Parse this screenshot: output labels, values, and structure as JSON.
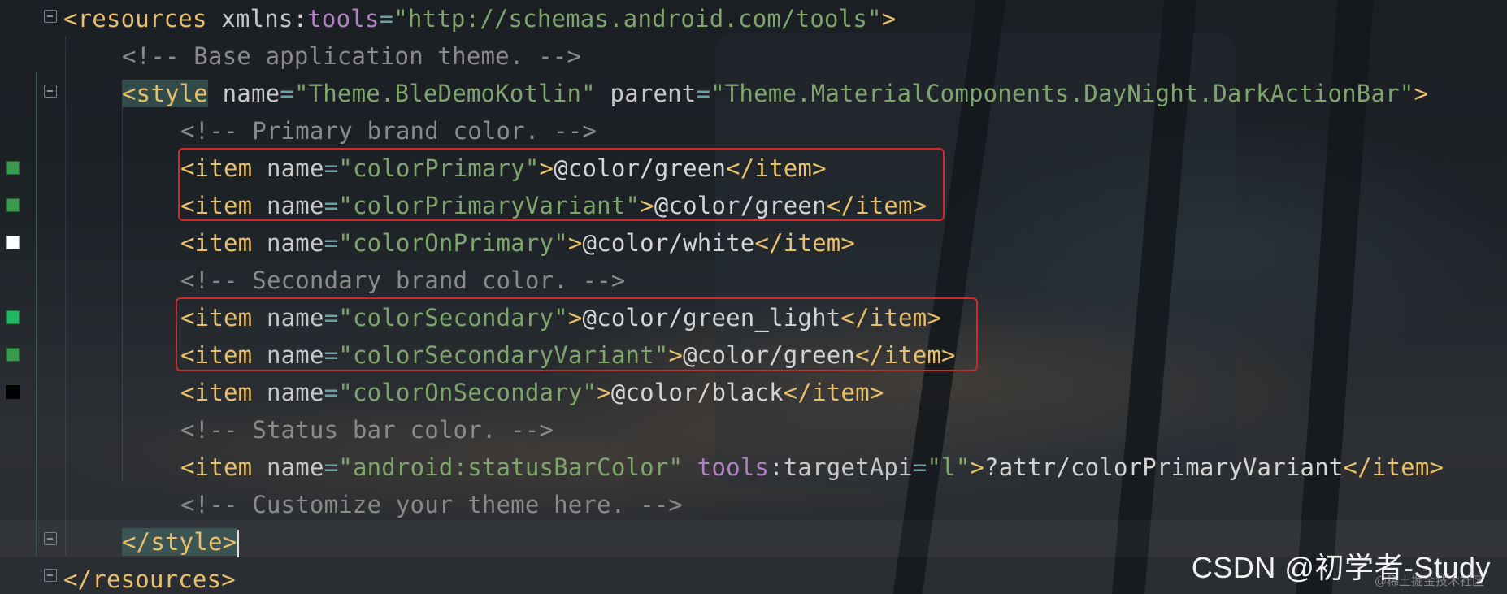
{
  "editor": {
    "lines": [
      {
        "segments": [
          {
            "t": "<",
            "c": "tag"
          },
          {
            "t": "resources",
            "c": "tag"
          },
          {
            "t": " xmlns",
            "c": "attr"
          },
          {
            "t": ":",
            "c": "txt"
          },
          {
            "t": "tools",
            "c": "ns"
          },
          {
            "t": "=",
            "c": "eq"
          },
          {
            "t": "\"http://schemas.android.com/tools\"",
            "c": "str"
          },
          {
            "t": ">",
            "c": "tag"
          }
        ]
      },
      {
        "segments": [
          {
            "t": "<!-- Base application theme. -->",
            "c": "cmt"
          }
        ]
      },
      {
        "segments": [
          {
            "t": "<style",
            "c": "tag-hl"
          },
          {
            "t": " name",
            "c": "attr"
          },
          {
            "t": "=",
            "c": "eq"
          },
          {
            "t": "\"Theme.BleDemoKotlin\"",
            "c": "str"
          },
          {
            "t": " parent",
            "c": "attr"
          },
          {
            "t": "=",
            "c": "eq"
          },
          {
            "t": "\"Theme.MaterialComponents.DayNight.DarkActionBar\"",
            "c": "str"
          },
          {
            "t": ">",
            "c": "tag"
          }
        ]
      },
      {
        "segments": [
          {
            "t": "<!-- Primary brand color. -->",
            "c": "cmt"
          }
        ]
      },
      {
        "segments": [
          {
            "t": "<item",
            "c": "tag"
          },
          {
            "t": " name",
            "c": "attr"
          },
          {
            "t": "=",
            "c": "eq"
          },
          {
            "t": "\"colorPrimary\"",
            "c": "str"
          },
          {
            "t": ">",
            "c": "tag"
          },
          {
            "t": "@color/green",
            "c": "txt"
          },
          {
            "t": "</item>",
            "c": "tag"
          }
        ]
      },
      {
        "segments": [
          {
            "t": "<item",
            "c": "tag"
          },
          {
            "t": " name",
            "c": "attr"
          },
          {
            "t": "=",
            "c": "eq"
          },
          {
            "t": "\"colorPrimaryVariant\"",
            "c": "str"
          },
          {
            "t": ">",
            "c": "tag"
          },
          {
            "t": "@color/green",
            "c": "txt"
          },
          {
            "t": "</item>",
            "c": "tag"
          }
        ]
      },
      {
        "segments": [
          {
            "t": "<item",
            "c": "tag"
          },
          {
            "t": " name",
            "c": "attr"
          },
          {
            "t": "=",
            "c": "eq"
          },
          {
            "t": "\"colorOnPrimary\"",
            "c": "str"
          },
          {
            "t": ">",
            "c": "tag"
          },
          {
            "t": "@color/white",
            "c": "txt"
          },
          {
            "t": "</item>",
            "c": "tag"
          }
        ]
      },
      {
        "segments": [
          {
            "t": "<!-- Secondary brand color. -->",
            "c": "cmt"
          }
        ]
      },
      {
        "segments": [
          {
            "t": "<item",
            "c": "tag"
          },
          {
            "t": " name",
            "c": "attr"
          },
          {
            "t": "=",
            "c": "eq"
          },
          {
            "t": "\"colorSecondary\"",
            "c": "str"
          },
          {
            "t": ">",
            "c": "tag"
          },
          {
            "t": "@color/green_light",
            "c": "txt"
          },
          {
            "t": "</item>",
            "c": "tag"
          }
        ]
      },
      {
        "segments": [
          {
            "t": "<item",
            "c": "tag"
          },
          {
            "t": " name",
            "c": "attr"
          },
          {
            "t": "=",
            "c": "eq"
          },
          {
            "t": "\"colorSecondaryVariant\"",
            "c": "str"
          },
          {
            "t": ">",
            "c": "tag"
          },
          {
            "t": "@color/green",
            "c": "txt"
          },
          {
            "t": "</item>",
            "c": "tag"
          }
        ]
      },
      {
        "segments": [
          {
            "t": "<item",
            "c": "tag"
          },
          {
            "t": " name",
            "c": "attr"
          },
          {
            "t": "=",
            "c": "eq"
          },
          {
            "t": "\"colorOnSecondary\"",
            "c": "str"
          },
          {
            "t": ">",
            "c": "tag"
          },
          {
            "t": "@color/black",
            "c": "txt"
          },
          {
            "t": "</item>",
            "c": "tag"
          }
        ]
      },
      {
        "segments": [
          {
            "t": "<!-- Status bar color. -->",
            "c": "cmt"
          }
        ]
      },
      {
        "segments": [
          {
            "t": "<item",
            "c": "tag"
          },
          {
            "t": " name",
            "c": "attr"
          },
          {
            "t": "=",
            "c": "eq"
          },
          {
            "t": "\"android:statusBarColor\"",
            "c": "str"
          },
          {
            "t": " tools",
            "c": "ns"
          },
          {
            "t": ":",
            "c": "txt"
          },
          {
            "t": "targetApi",
            "c": "attr"
          },
          {
            "t": "=",
            "c": "eq"
          },
          {
            "t": "\"l\"",
            "c": "str"
          },
          {
            "t": ">",
            "c": "tag"
          },
          {
            "t": "?attr/colorPrimaryVariant",
            "c": "txt"
          },
          {
            "t": "</item>",
            "c": "tag"
          }
        ]
      },
      {
        "segments": [
          {
            "t": "<!-- Customize your theme here. -->",
            "c": "cmt"
          }
        ]
      },
      {
        "segments": [
          {
            "t": "</style>",
            "c": "tag-hl"
          }
        ]
      },
      {
        "segments": [
          {
            "t": "</resources>",
            "c": "tag"
          }
        ]
      }
    ],
    "gutter_swatches": [
      {
        "line": 4,
        "color": "#3a9a4e"
      },
      {
        "line": 5,
        "color": "#3a9a4e"
      },
      {
        "line": 6,
        "color": "#ffffff"
      },
      {
        "line": 8,
        "color": "#20b860"
      },
      {
        "line": 9,
        "color": "#3a9a4e"
      },
      {
        "line": 10,
        "color": "#000000"
      }
    ]
  },
  "watermark": {
    "text": "CSDN @初学者-Study",
    "sub": "@稀土掘金技术社区"
  },
  "colors": {
    "highlight_border": "#d12a2a",
    "tag": "#e8bf6a",
    "string": "#7fa56d",
    "comment": "#8a8a8a"
  }
}
